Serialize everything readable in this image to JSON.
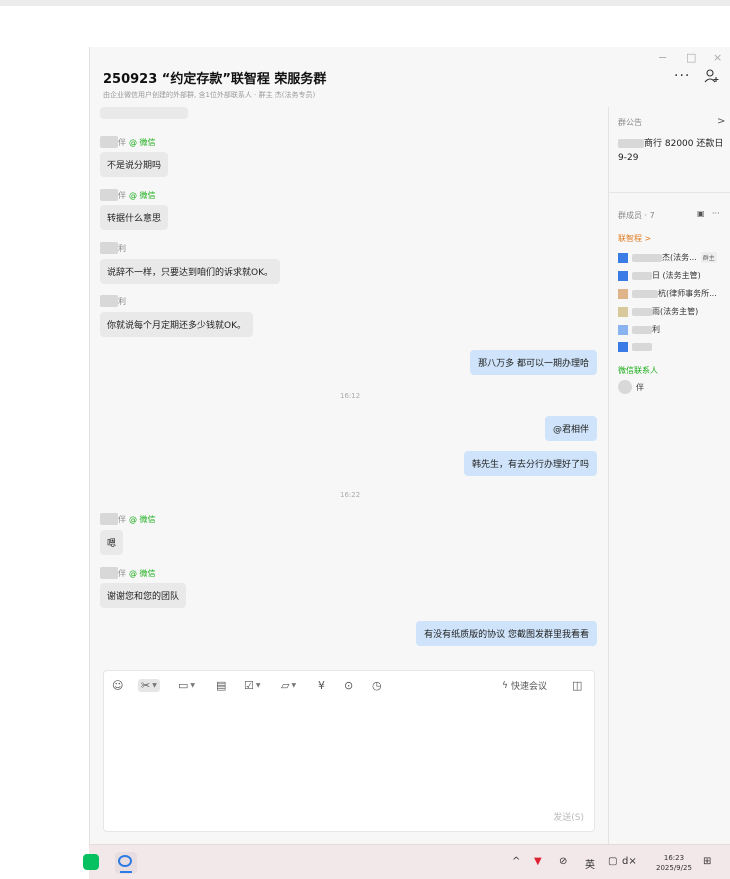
{
  "header": {
    "title": "250923 “约定存款”联智程 荣服务群",
    "subtitle": "由企业微信用户创建的外部群, 含1位外部联系人 · 群主 杰(法务专员)",
    "more_icon": "···"
  },
  "window_controls": {
    "minimize": "−",
    "maximize": "□",
    "close": "×"
  },
  "messages": [
    {
      "sender": "伴",
      "tag": "@ 微信",
      "text": "不是说分期吗"
    },
    {
      "sender": "伴",
      "tag": "@ 微信",
      "text": "转据什么意思"
    },
    {
      "sender": "利",
      "tag": "",
      "text": "说辞不一样，只要达到咱们的诉求就OK。"
    },
    {
      "sender": "利",
      "tag": "",
      "text": "你就说每个月定期还多少钱就OK。"
    },
    {
      "text": "那八万多 都可以一期办理哈"
    },
    {
      "time": "16:12"
    },
    {
      "text": "@君相伴"
    },
    {
      "text": "韩先生，有去分行办理好了吗"
    },
    {
      "time": "16:22"
    },
    {
      "sender": "伴",
      "tag": "@ 微信",
      "text": "嗯"
    },
    {
      "sender": "伴",
      "tag": "@ 微信",
      "text": "谢谢您和您的团队"
    },
    {
      "text": "有没有纸质版的协议 您截图发群里我看看"
    }
  ],
  "composer": {
    "quick_meeting": "快速会议",
    "send": "发送(S)",
    "icons": [
      "smile-icon",
      "scissors-icon",
      "image-icon",
      "doc-icon",
      "checklist-icon",
      "folder-icon",
      "yen-icon",
      "more-circle-icon",
      "clock-icon",
      "lightning-icon",
      "panel-icon"
    ]
  },
  "sidebar": {
    "announce_label": "群公告",
    "announce_arrow": ">",
    "announce_text": "商行 82000 还款日9-29",
    "members_label": "群成员 · 7",
    "members_more": "···",
    "org_label": "联智程 >",
    "members": [
      {
        "name": "杰(法务...",
        "badge": "群主",
        "color": "#3b7be6"
      },
      {
        "name": "日 (法务主管)",
        "badge": "",
        "color": "#3b7be6"
      },
      {
        "name": "杭(律师事务所...",
        "badge": "",
        "color": "#e0b48a"
      },
      {
        "name": "雨(法务主管)",
        "badge": "",
        "color": "#d9c89a"
      },
      {
        "name": "利",
        "badge": "",
        "color": "#8ab4f0"
      },
      {
        "name": "",
        "badge": "",
        "color": "#3b7be6"
      }
    ],
    "wechat_label": "微信联系人",
    "wechat_member": "伴"
  },
  "taskbar": {
    "tray_items": [
      "^",
      "英",
      "d×"
    ],
    "time": "16:23",
    "date": "2025/9/25"
  },
  "colors": {
    "bubble_right": "#cfe4fb",
    "bubble_left": "#e9e9e9",
    "wechat_green": "#1aad19",
    "accent_orange": "#e07a1f"
  }
}
